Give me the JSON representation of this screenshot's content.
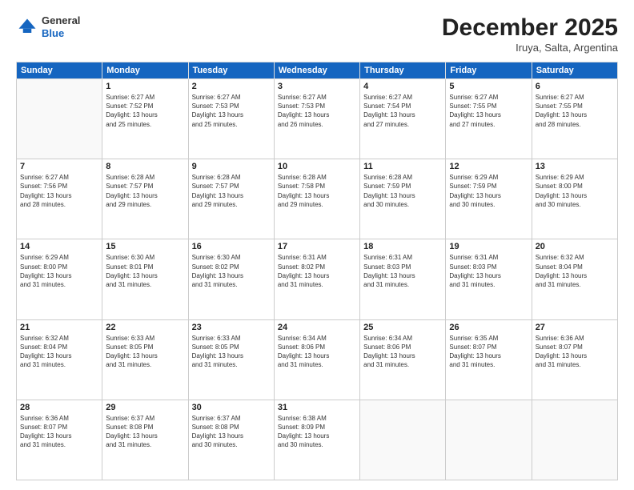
{
  "header": {
    "logo_general": "General",
    "logo_blue": "Blue",
    "month": "December 2025",
    "location": "Iruya, Salta, Argentina"
  },
  "days_of_week": [
    "Sunday",
    "Monday",
    "Tuesday",
    "Wednesday",
    "Thursday",
    "Friday",
    "Saturday"
  ],
  "weeks": [
    [
      {
        "day": "",
        "info": ""
      },
      {
        "day": "1",
        "info": "Sunrise: 6:27 AM\nSunset: 7:52 PM\nDaylight: 13 hours\nand 25 minutes."
      },
      {
        "day": "2",
        "info": "Sunrise: 6:27 AM\nSunset: 7:53 PM\nDaylight: 13 hours\nand 25 minutes."
      },
      {
        "day": "3",
        "info": "Sunrise: 6:27 AM\nSunset: 7:53 PM\nDaylight: 13 hours\nand 26 minutes."
      },
      {
        "day": "4",
        "info": "Sunrise: 6:27 AM\nSunset: 7:54 PM\nDaylight: 13 hours\nand 27 minutes."
      },
      {
        "day": "5",
        "info": "Sunrise: 6:27 AM\nSunset: 7:55 PM\nDaylight: 13 hours\nand 27 minutes."
      },
      {
        "day": "6",
        "info": "Sunrise: 6:27 AM\nSunset: 7:55 PM\nDaylight: 13 hours\nand 28 minutes."
      }
    ],
    [
      {
        "day": "7",
        "info": "Sunrise: 6:27 AM\nSunset: 7:56 PM\nDaylight: 13 hours\nand 28 minutes."
      },
      {
        "day": "8",
        "info": "Sunrise: 6:28 AM\nSunset: 7:57 PM\nDaylight: 13 hours\nand 29 minutes."
      },
      {
        "day": "9",
        "info": "Sunrise: 6:28 AM\nSunset: 7:57 PM\nDaylight: 13 hours\nand 29 minutes."
      },
      {
        "day": "10",
        "info": "Sunrise: 6:28 AM\nSunset: 7:58 PM\nDaylight: 13 hours\nand 29 minutes."
      },
      {
        "day": "11",
        "info": "Sunrise: 6:28 AM\nSunset: 7:59 PM\nDaylight: 13 hours\nand 30 minutes."
      },
      {
        "day": "12",
        "info": "Sunrise: 6:29 AM\nSunset: 7:59 PM\nDaylight: 13 hours\nand 30 minutes."
      },
      {
        "day": "13",
        "info": "Sunrise: 6:29 AM\nSunset: 8:00 PM\nDaylight: 13 hours\nand 30 minutes."
      }
    ],
    [
      {
        "day": "14",
        "info": "Sunrise: 6:29 AM\nSunset: 8:00 PM\nDaylight: 13 hours\nand 31 minutes."
      },
      {
        "day": "15",
        "info": "Sunrise: 6:30 AM\nSunset: 8:01 PM\nDaylight: 13 hours\nand 31 minutes."
      },
      {
        "day": "16",
        "info": "Sunrise: 6:30 AM\nSunset: 8:02 PM\nDaylight: 13 hours\nand 31 minutes."
      },
      {
        "day": "17",
        "info": "Sunrise: 6:31 AM\nSunset: 8:02 PM\nDaylight: 13 hours\nand 31 minutes."
      },
      {
        "day": "18",
        "info": "Sunrise: 6:31 AM\nSunset: 8:03 PM\nDaylight: 13 hours\nand 31 minutes."
      },
      {
        "day": "19",
        "info": "Sunrise: 6:31 AM\nSunset: 8:03 PM\nDaylight: 13 hours\nand 31 minutes."
      },
      {
        "day": "20",
        "info": "Sunrise: 6:32 AM\nSunset: 8:04 PM\nDaylight: 13 hours\nand 31 minutes."
      }
    ],
    [
      {
        "day": "21",
        "info": "Sunrise: 6:32 AM\nSunset: 8:04 PM\nDaylight: 13 hours\nand 31 minutes."
      },
      {
        "day": "22",
        "info": "Sunrise: 6:33 AM\nSunset: 8:05 PM\nDaylight: 13 hours\nand 31 minutes."
      },
      {
        "day": "23",
        "info": "Sunrise: 6:33 AM\nSunset: 8:05 PM\nDaylight: 13 hours\nand 31 minutes."
      },
      {
        "day": "24",
        "info": "Sunrise: 6:34 AM\nSunset: 8:06 PM\nDaylight: 13 hours\nand 31 minutes."
      },
      {
        "day": "25",
        "info": "Sunrise: 6:34 AM\nSunset: 8:06 PM\nDaylight: 13 hours\nand 31 minutes."
      },
      {
        "day": "26",
        "info": "Sunrise: 6:35 AM\nSunset: 8:07 PM\nDaylight: 13 hours\nand 31 minutes."
      },
      {
        "day": "27",
        "info": "Sunrise: 6:36 AM\nSunset: 8:07 PM\nDaylight: 13 hours\nand 31 minutes."
      }
    ],
    [
      {
        "day": "28",
        "info": "Sunrise: 6:36 AM\nSunset: 8:07 PM\nDaylight: 13 hours\nand 31 minutes."
      },
      {
        "day": "29",
        "info": "Sunrise: 6:37 AM\nSunset: 8:08 PM\nDaylight: 13 hours\nand 31 minutes."
      },
      {
        "day": "30",
        "info": "Sunrise: 6:37 AM\nSunset: 8:08 PM\nDaylight: 13 hours\nand 30 minutes."
      },
      {
        "day": "31",
        "info": "Sunrise: 6:38 AM\nSunset: 8:09 PM\nDaylight: 13 hours\nand 30 minutes."
      },
      {
        "day": "",
        "info": ""
      },
      {
        "day": "",
        "info": ""
      },
      {
        "day": "",
        "info": ""
      }
    ]
  ]
}
